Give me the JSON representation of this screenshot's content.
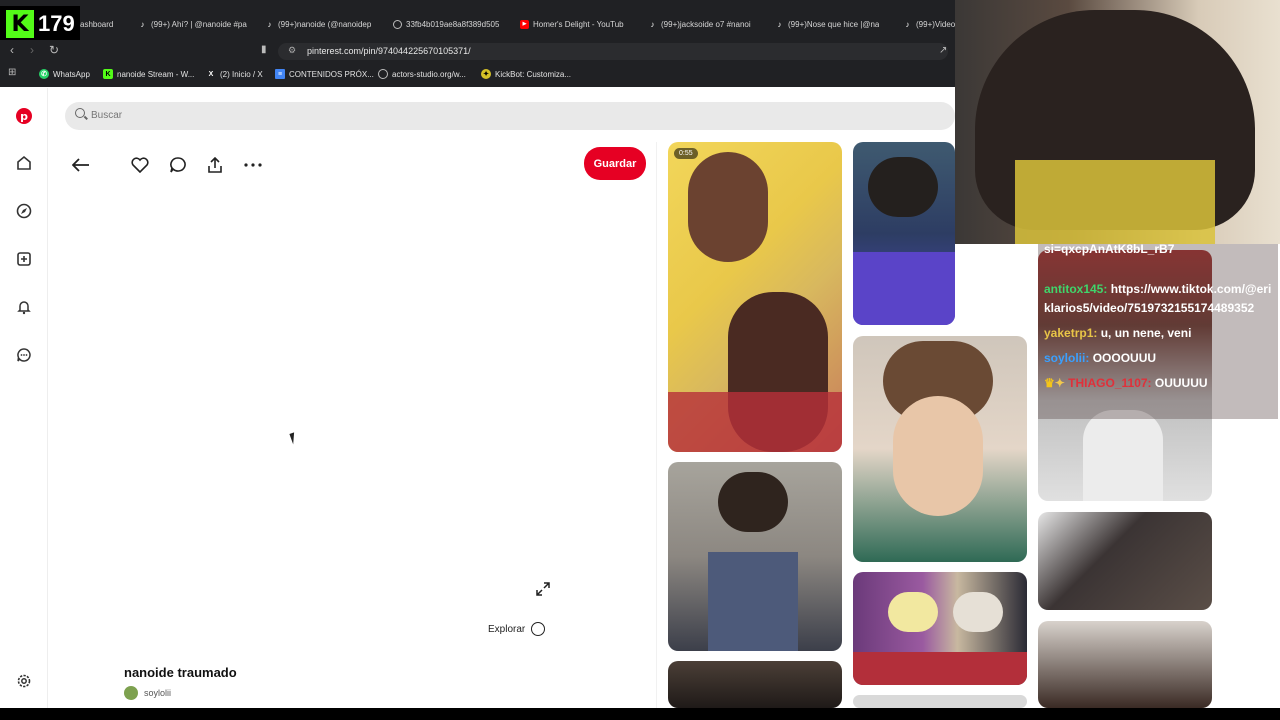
{
  "stream": {
    "viewer_count": "179",
    "logo": "K"
  },
  "tabs": [
    {
      "label": "ashboard",
      "icon": "none"
    },
    {
      "label": "(99+) Ahí? | @nanoide #pa",
      "icon": "tiktok-icon"
    },
    {
      "label": "(99+)nanoide (@nanoidep",
      "icon": "tiktok-icon"
    },
    {
      "label": "33fb4b019ae8a8f389d505",
      "icon": "globe-icon"
    },
    {
      "label": "Homer's Delight - YouTub",
      "icon": "youtube-icon"
    },
    {
      "label": "(99+)jacksoide o7 #nanoi",
      "icon": "tiktok-icon"
    },
    {
      "label": "(99+)Nose que hice |@na",
      "icon": "tiktok-icon"
    },
    {
      "label": "(99+)Video",
      "icon": "tiktok-icon"
    }
  ],
  "address": {
    "url": "pinterest.com/pin/974044225670105371/"
  },
  "bookmarks": [
    {
      "label": "WhatsApp",
      "icon": "whatsapp-icon"
    },
    {
      "label": "nanoide Stream - W...",
      "icon": "kick-icon"
    },
    {
      "label": "(2) Inicio / X",
      "icon": "x-icon"
    },
    {
      "label": "CONTENIDOS PRÓX...",
      "icon": "docs-icon"
    },
    {
      "label": "actors-studio.org/w...",
      "icon": "globe-icon"
    },
    {
      "label": "KickBot: Customiza...",
      "icon": "kickbot-icon"
    }
  ],
  "search": {
    "placeholder": "Buscar"
  },
  "pin": {
    "save_label": "Guardar",
    "title": "nanoide traumado",
    "username": "soylolii",
    "explore_label": "Explorar"
  },
  "grid": {
    "video_duration": "0:55"
  },
  "chat": {
    "messages": [
      {
        "user": "",
        "text": "si=qxcpAnAtK8bL_rB7",
        "color": "#ffffff"
      },
      {
        "user": "antitox145:",
        "text": "https://www.tiktok.com/@eriklarios5/video/7519732155174489352",
        "color": "#3fd56b"
      },
      {
        "user": "yaketrp1:",
        "text": "u, un nene, veni",
        "color": "#e8c547"
      },
      {
        "user": "soylolii:",
        "text": "OOOOUUU",
        "color": "#3aa0ff"
      },
      {
        "user": "THIAGO_1107:",
        "text": "OUUUUU",
        "color": "#e0303a"
      }
    ]
  },
  "colors": {
    "pinterest_red": "#e60023",
    "kick_green": "#53fc18"
  }
}
